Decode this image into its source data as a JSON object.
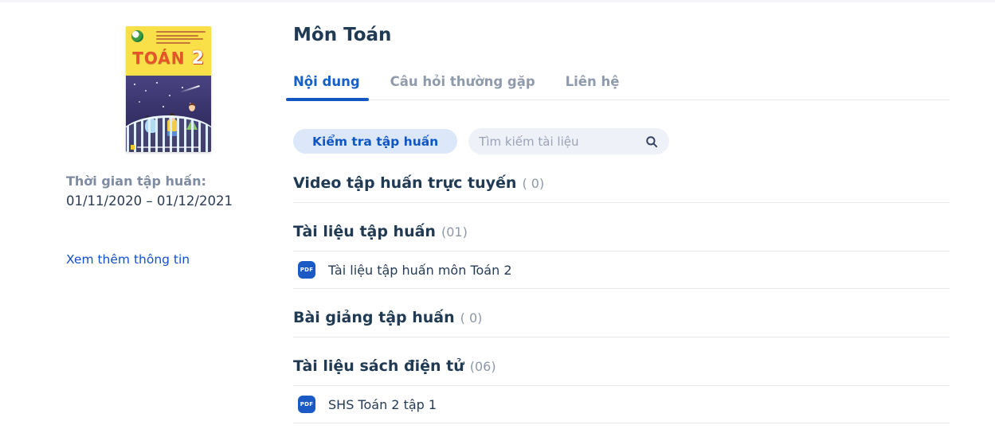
{
  "sidebar": {
    "book": {
      "title_word": "TOÁN",
      "title_number": "2"
    },
    "training_time_label": "Thời gian tập huấn:",
    "training_time_value": "01/11/2020 – 01/12/2021",
    "more_info_link": "Xem thêm thông tin"
  },
  "main": {
    "title": "Môn Toán",
    "tabs": [
      {
        "label": "Nội dung",
        "active": true
      },
      {
        "label": "Câu hỏi thường gặp",
        "active": false
      },
      {
        "label": "Liên hệ",
        "active": false
      }
    ],
    "check_button_label": "Kiểm tra tập huấn",
    "search_placeholder": "Tìm kiếm tài liệu",
    "pdf_icon_label": "PDF",
    "sections": [
      {
        "title": "Video tập huấn trực tuyến",
        "count": "( 0)"
      },
      {
        "title": "Tài liệu tập huấn",
        "count": "(01)",
        "items": [
          {
            "label": "Tài liệu tập huấn môn Toán 2"
          }
        ]
      },
      {
        "title": "Bài giảng tập huấn",
        "count": "( 0)"
      },
      {
        "title": "Tài liệu sách điện tử",
        "count": "(06)",
        "items": [
          {
            "label": "SHS Toán 2 tập 1"
          }
        ]
      }
    ]
  },
  "colors": {
    "accent_blue": "#1560c8",
    "heading_navy": "#203a54",
    "tab_inactive_gray": "#8f9aab",
    "button_bg": "#dce8fa",
    "search_bg": "#eef1f8",
    "divider": "#e6e8ee",
    "pdf_badge_bg": "#1b5ac4",
    "cover_yellow": "#f9e049",
    "cover_night": "#353066"
  }
}
